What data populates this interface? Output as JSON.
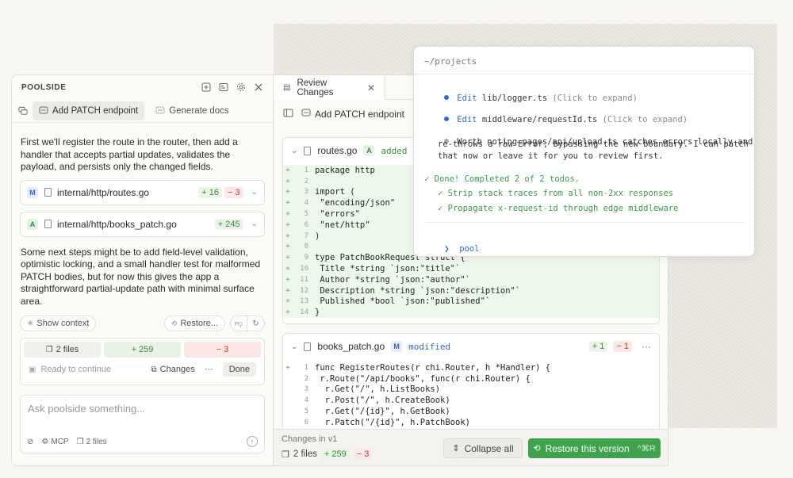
{
  "left_panel": {
    "title": "POOLSIDE",
    "tabs": [
      {
        "label": "Add PATCH endpoint"
      },
      {
        "label": "Generate docs"
      }
    ],
    "intro": "First we'll register the route in the router, then add a handler that accepts partial updates, validates the payload, and persists only the changed fields.",
    "files": [
      {
        "badge": "M",
        "path": "internal/http/routes.go",
        "added": "+ 16",
        "removed": "− 3"
      },
      {
        "badge": "A",
        "path": "internal/http/books_patch.go",
        "added": "+ 245",
        "removed": ""
      }
    ],
    "next_steps": "Some next steps might be to add field-level validation, optimistic locking, and a small handler test for malformed PATCH bodies, but for now this gives the app a straightforward partial-update path with minimal surface area.",
    "show_context": "Show context",
    "restore": "Restore...",
    "summary": {
      "files": "2 files",
      "added": "+ 259",
      "removed": "− 3"
    },
    "ready": "Ready to continue",
    "changes": "Changes",
    "more": "···",
    "done": "Done",
    "composer": {
      "placeholder": "Ask poolside something...",
      "mcp": "MCP",
      "files": "2 files"
    }
  },
  "review": {
    "tab_label": "Review Changes",
    "subtitle": "Add PATCH endpoint",
    "file1": {
      "name": "routes.go",
      "badge": "A",
      "status": "added",
      "lines": [
        {
          "n": "1",
          "t": "package http"
        },
        {
          "n": "2",
          "t": ""
        },
        {
          "n": "3",
          "t": "import ("
        },
        {
          "n": "4",
          "t": " \"encoding/json\""
        },
        {
          "n": "5",
          "t": " \"errors\""
        },
        {
          "n": "6",
          "t": " \"net/http\""
        },
        {
          "n": "7",
          "t": ")"
        },
        {
          "n": "8",
          "t": ""
        },
        {
          "n": "9",
          "t": "type PatchBookRequest struct {"
        },
        {
          "n": "10",
          "t": " Title *string `json:\"title\"`"
        },
        {
          "n": "11",
          "t": " Author *string `json:\"author\"`"
        },
        {
          "n": "12",
          "t": " Description *string `json:\"description\"`"
        },
        {
          "n": "13",
          "t": " Published *bool `json:\"published\"`"
        },
        {
          "n": "14",
          "t": "}"
        }
      ]
    },
    "file2": {
      "name": "books_patch.go",
      "badge": "M",
      "status": "modified",
      "added": "+ 1",
      "removed": "− 1",
      "more": "···",
      "lines": [
        {
          "n": "1",
          "s": "+",
          "t": "func RegisterRoutes(r chi.Router, h *Handler) {"
        },
        {
          "n": "2",
          "s": "",
          "t": " r.Route(\"/api/books\", func(r chi.Router) {"
        },
        {
          "n": "3",
          "s": "",
          "t": "  r.Get(\"/\", h.ListBooks)"
        },
        {
          "n": "4",
          "s": "",
          "t": "  r.Post(\"/\", h.CreateBook)"
        },
        {
          "n": "5",
          "s": "",
          "t": "  r.Get(\"/{id}\", h.GetBook)"
        },
        {
          "n": "6",
          "s": "",
          "t": "  r.Patch(\"/{id}\", h.PatchBook)"
        }
      ]
    },
    "footer": {
      "title": "Changes in v1",
      "files": "2 files",
      "added": "+ 259",
      "removed": "− 3",
      "collapse": "Collapse all",
      "restore": "Restore this version",
      "shortcut": "^⌘R"
    }
  },
  "terminal": {
    "cwd": "~/projects",
    "edit1_kw": "Edit",
    "edit1_file": "lib/logger.ts",
    "edit1_hint": "(Click to expand)",
    "edit2_kw": "Edit",
    "edit2_file": "middleware/requestId.ts",
    "edit2_hint": "(Click to expand)",
    "note1": "Worth noting—pages/api/upload.ts catches errors locally and",
    "note2": "re-throws a raw Error, bypassing the new boundary. I can patch",
    "note3": "that now or leave it for you to review first.",
    "done": "✓ Done! Completed 2 of 2 todos.",
    "todo1": "✓ Strip stack traces from all non-2xx responses",
    "todo2": "✓ Propagate x-request-id through edge middleware",
    "prompt": "❯",
    "input": "pool"
  },
  "colors": {
    "accent_green": "#3fa34d",
    "accent_blue": "#2d6ad6",
    "removed_red": "#cc3333"
  }
}
